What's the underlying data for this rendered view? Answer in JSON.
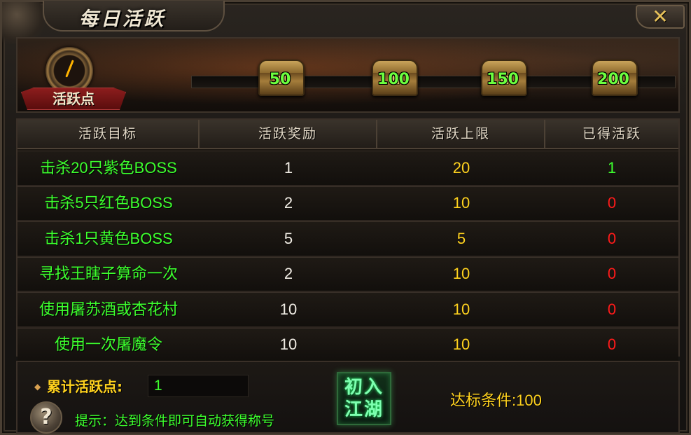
{
  "window": {
    "title": "每日活跃",
    "close_symbol": "✕"
  },
  "banner": {
    "medal_label": "活跃点",
    "milestones": [
      {
        "value": "50"
      },
      {
        "value": "100"
      },
      {
        "value": "150"
      },
      {
        "value": "200"
      }
    ],
    "progress_fraction": 0.005
  },
  "table": {
    "headers": [
      "活跃目标",
      "活跃奖励",
      "活跃上限",
      "已得活跃"
    ],
    "rows": [
      {
        "target": "击杀20只紫色BOSS",
        "reward": "1",
        "limit": "20",
        "got": "1"
      },
      {
        "target": "击杀5只红色BOSS",
        "reward": "2",
        "limit": "10",
        "got": "0"
      },
      {
        "target": "击杀1只黄色BOSS",
        "reward": "5",
        "limit": "5",
        "got": "0"
      },
      {
        "target": "寻找王瞎子算命一次",
        "reward": "2",
        "limit": "10",
        "got": "0"
      },
      {
        "target": "使用屠苏酒或杏花村",
        "reward": "10",
        "limit": "10",
        "got": "0"
      },
      {
        "target": "使用一次屠魔令",
        "reward": "10",
        "limit": "10",
        "got": "0"
      }
    ]
  },
  "bottom": {
    "sum_label": "累计活跃点:",
    "sum_value": "1",
    "hint": "提示：达到条件即可自动获得称号",
    "help_symbol": "?",
    "title_badge": [
      "初入",
      "江湖"
    ],
    "condition": "达标条件:100"
  },
  "colors": {
    "green": "#3dff2e",
    "yellow": "#ffd21e",
    "red": "#ff1a1a",
    "white": "#f0ece4"
  }
}
